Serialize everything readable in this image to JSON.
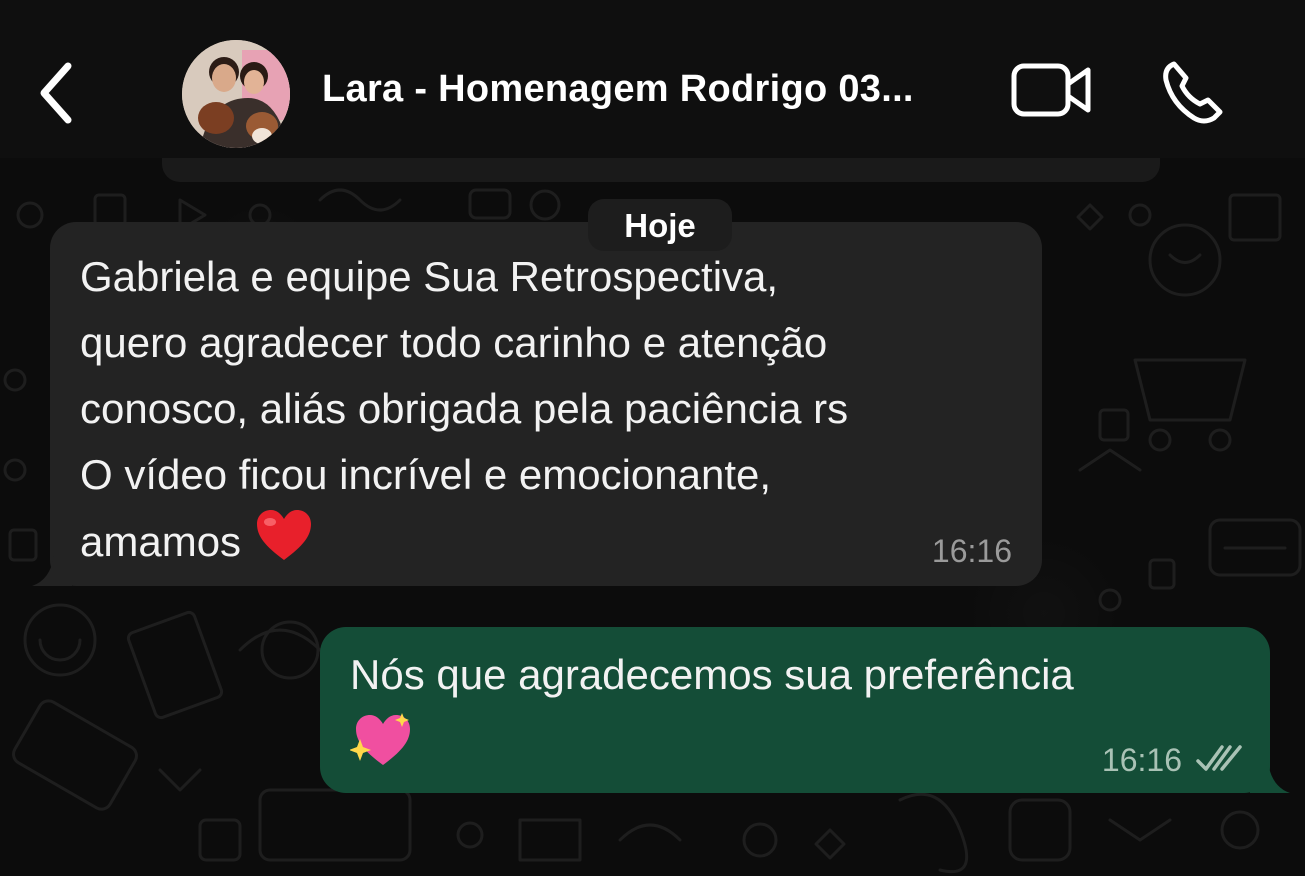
{
  "header": {
    "back_icon": "chevron-left-icon",
    "contact_name": "Lara - Homenagem Rodrigo 03...",
    "video_icon": "video-camera-icon",
    "call_icon": "phone-icon"
  },
  "date_separator": "Hoje",
  "messages": [
    {
      "direction": "incoming",
      "lines": [
        "Gabriela e equipe Sua Retrospectiva,",
        "quero agradecer todo carinho e atenção",
        "conosco, aliás obrigada pela paciência rs",
        "O vídeo ficou incrível e emocionante,",
        "amamos"
      ],
      "emoji": "red-heart-icon",
      "time": "16:16"
    },
    {
      "direction": "outgoing",
      "text": "Nós que agradecemos sua preferência",
      "emoji": "sparkling-heart-icon",
      "time": "16:16",
      "status_icon": "double-check-icon"
    }
  ],
  "colors": {
    "header_bg": "#0f0f0f",
    "incoming_bubble": "#232323",
    "outgoing_bubble": "#144d37",
    "text": "#f2f2f2",
    "timestamp": "#9a9a9a"
  }
}
